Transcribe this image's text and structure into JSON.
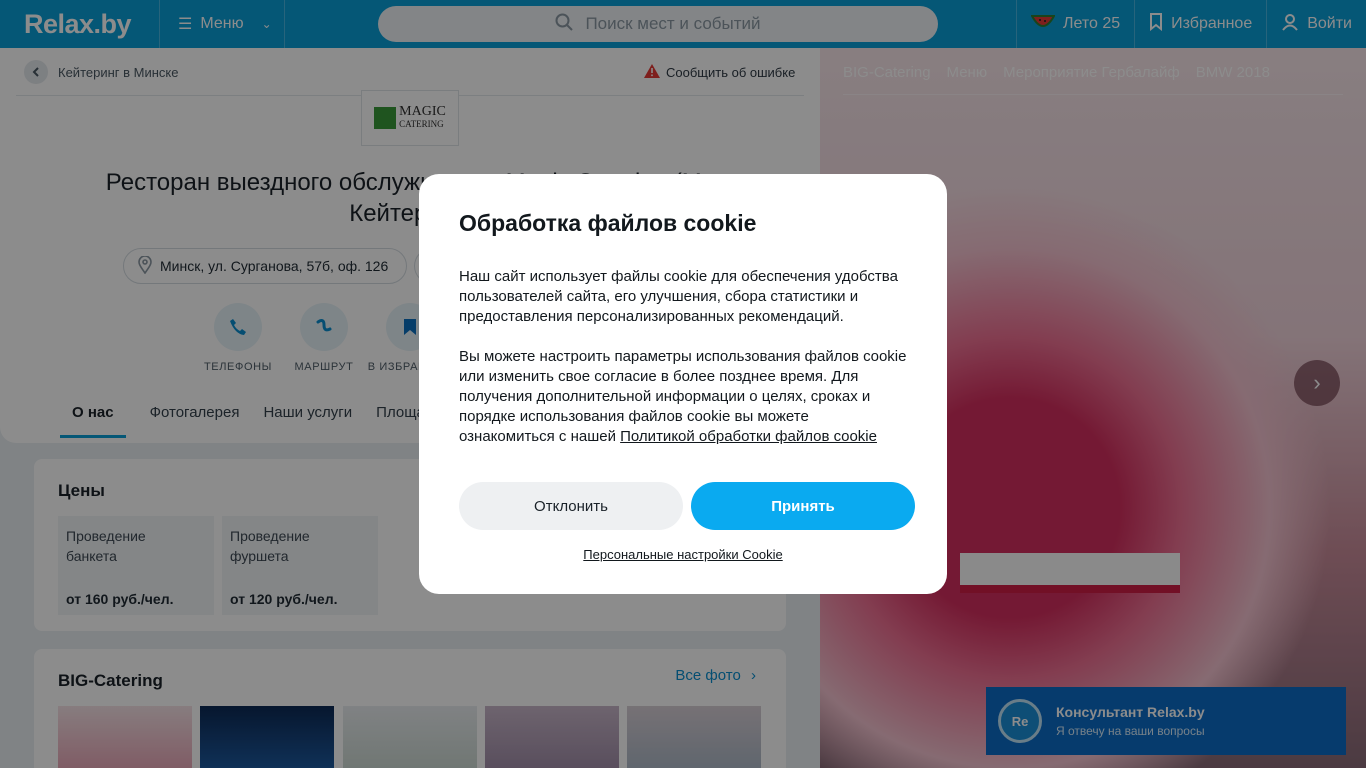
{
  "header": {
    "logo": "Relax.by",
    "menu_label": "Меню",
    "search_placeholder": "Поиск мест и событий",
    "summer_label": "Лето 25",
    "favorites_label": "Избранное",
    "login_label": "Войти"
  },
  "breadcrumb": {
    "back_label": "Кейтеринг в Минске"
  },
  "report_label": "Сообщить об ошибке",
  "brand_logo": {
    "line1": "MAGIC",
    "line2": "CATERING"
  },
  "venue": {
    "title_line1": "Ресторан выездного обслуживания Magic Catering (Мэ",
    "title_line2": "Кейтеринг)",
    "address": "Минск, ул. Сурганова, 57б, оф. 126"
  },
  "actions": [
    {
      "label": "ТЕЛЕФОНЫ",
      "icon": "phone-icon"
    },
    {
      "label": "МАРШРУТ",
      "icon": "route-icon"
    },
    {
      "label": "В ИЗБРАННОЕ",
      "icon": "bookmark-icon"
    }
  ],
  "tabs": [
    "О нас",
    "Фотогалерея",
    "Наши услуги",
    "Площадки"
  ],
  "prices": {
    "title": "Цены",
    "items": [
      {
        "name": "Проведение банкета",
        "value": "от 160 руб./чел."
      },
      {
        "name": "Проведение фуршета",
        "value": "от 120 руб./чел."
      }
    ]
  },
  "gallery": {
    "title": "BIG-Catering",
    "all_photos": "Все фото"
  },
  "photo_tabs": [
    "BIG-Catering",
    "Меню",
    "Мероприятие Гербалайф",
    "BMW 2018"
  ],
  "consultant": {
    "avatar": "Re",
    "title": "Консультант Relax.by",
    "subtitle": "Я отвечу на ваши вопросы"
  },
  "cookie_modal": {
    "title": "Обработка файлов cookie",
    "paragraph1": "Наш сайт использует файлы cookie для обеспечения удобства пользователей сайта, его улучшения, сбора статистики и предоставления персонализированных рекомендаций.",
    "paragraph2": "Вы можете настроить параметры использования файлов cookie или изменить свое согласие в более позднее время. Для получения дополнительной информации о целях, сроках и порядке использования файлов cookie вы можете ознакомиться с нашей",
    "policy_link": "Политикой обработки файлов cookie",
    "decline_label": "Отклонить",
    "accept_label": "Принять",
    "settings_link": "Персональные настройки Cookie"
  },
  "colors": {
    "brand": "#0a9fd8",
    "accept": "#0aaaf0",
    "consultant_bg": "#0b6cc7"
  }
}
